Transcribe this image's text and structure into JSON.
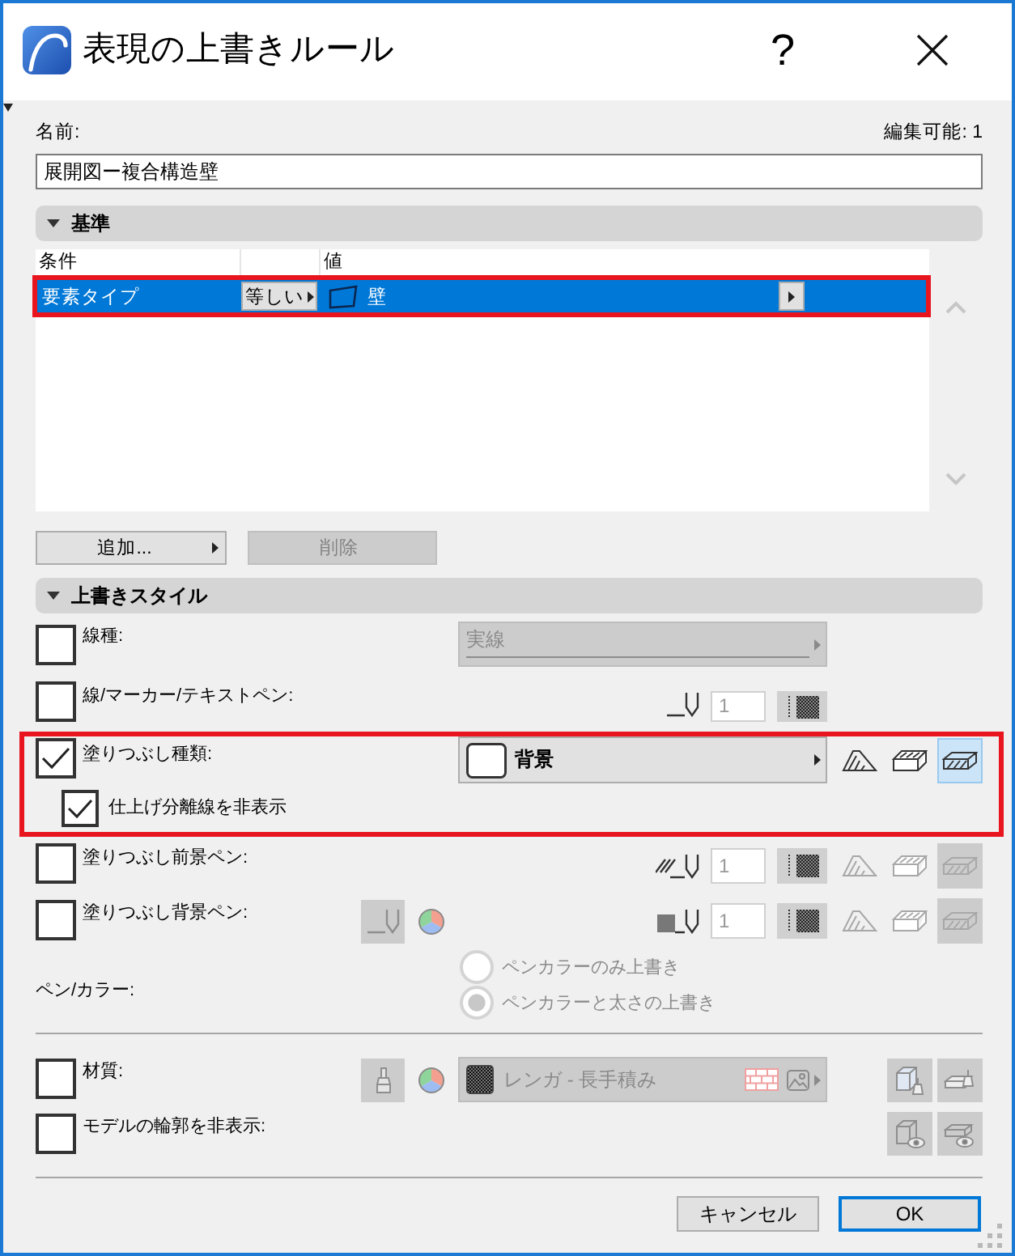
{
  "window": {
    "title": "表現の上書きルール",
    "help": "?"
  },
  "name": {
    "label": "名前:",
    "editable": "編集可能: 1",
    "value": "展開図ー複合構造壁"
  },
  "criteria": {
    "header": "基準",
    "expanded": true,
    "columns": {
      "condition": "条件",
      "value": "値"
    },
    "rows": [
      {
        "condition": "要素タイプ",
        "operator": "等しい",
        "value": "壁",
        "selected": true,
        "highlighted": true
      }
    ],
    "buttons": [
      {
        "label": "追加...",
        "disabled": false,
        "menu": true
      },
      {
        "label": "削除",
        "disabled": true,
        "menu": false
      }
    ]
  },
  "override_style": {
    "header": "上書きスタイル",
    "expanded": true,
    "line_type": {
      "label": "線種:",
      "checked": false,
      "value": "実線",
      "disabled": true
    },
    "line_pen": {
      "label": "線/マーカー/テキストペン:",
      "checked": false,
      "pen": "1"
    },
    "fill_type": {
      "label": "塗りつぶし種類:",
      "checked": true,
      "value": "背景",
      "disabled": false,
      "highlighted": true,
      "modes_disabled": false,
      "modes": [
        {
          "selected": false
        },
        {
          "selected": false
        },
        {
          "selected": true
        }
      ],
      "hide_separator": {
        "label": "仕上げ分離線を非表示",
        "checked": true
      }
    },
    "fill_fg_pen": {
      "label": "塗りつぶし前景ペン:",
      "checked": false,
      "pen": "1",
      "modes_disabled": true,
      "modes": [
        {
          "selected": false
        },
        {
          "selected": false
        },
        {
          "selected": true
        }
      ]
    },
    "fill_bg_pen": {
      "label": "塗りつぶし背景ペン:",
      "checked": false,
      "pen": "1",
      "pen_button_disabled": true,
      "modes_disabled": true,
      "modes": [
        {
          "selected": false
        },
        {
          "selected": false
        },
        {
          "selected": true
        }
      ]
    },
    "pen_color": {
      "label": "ペン/カラー:",
      "disabled": true,
      "options": [
        {
          "label": "ペンカラーのみ上書き",
          "selected": false
        },
        {
          "label": "ペンカラーと太さの上書き",
          "selected": true
        }
      ]
    },
    "material": {
      "label": "材質:",
      "checked": false,
      "value": "レンガ - 長手積み",
      "disabled": true
    },
    "hide_contour": {
      "label": "モデルの輪郭を非表示:",
      "checked": false,
      "disabled": true
    }
  },
  "buttons": [
    {
      "label": "キャンセル",
      "default": false
    },
    {
      "label": "OK",
      "default": true
    }
  ]
}
